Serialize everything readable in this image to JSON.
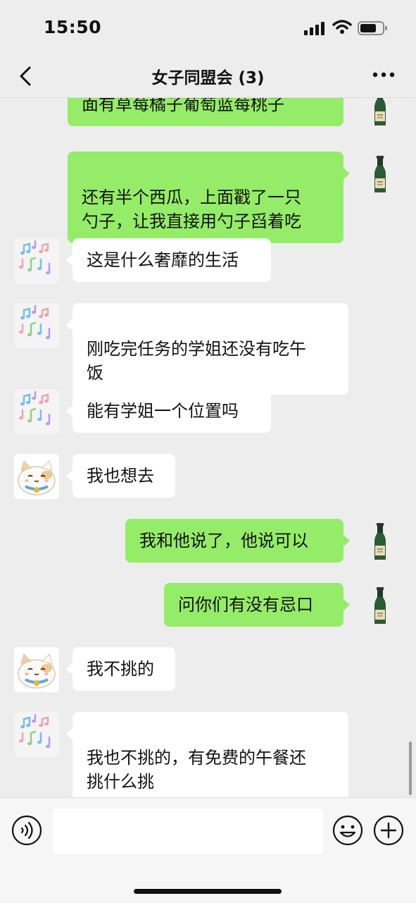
{
  "status_bar": {
    "time": "15:50"
  },
  "header": {
    "title": "女子同盟会 (3)"
  },
  "messages": [
    {
      "side": "right",
      "text": "面有草莓橘子葡萄蓝莓桃子",
      "avatar": "wine-bottle-avatar"
    },
    {
      "side": "right",
      "text": "还有半个西瓜，上面戳了一只\n勺子，让我直接用勺子舀着吃",
      "avatar": "wine-bottle-avatar"
    },
    {
      "side": "left",
      "text": "这是什么奢靡的生活",
      "avatar": "music-notes-avatar"
    },
    {
      "side": "left",
      "text": "刚吃完任务的学姐还没有吃午\n饭",
      "avatar": "music-notes-avatar"
    },
    {
      "side": "left",
      "text": "能有学姐一个位置吗",
      "avatar": "music-notes-avatar"
    },
    {
      "side": "left",
      "text": "我也想去",
      "avatar": "lucky-cat-avatar"
    },
    {
      "side": "right",
      "text": "我和他说了，他说可以",
      "avatar": "wine-bottle-avatar"
    },
    {
      "side": "right",
      "text": "问你们有没有忌口",
      "avatar": "wine-bottle-avatar"
    },
    {
      "side": "left",
      "text": "我不挑的",
      "avatar": "lucky-cat-avatar"
    },
    {
      "side": "left",
      "text": "我也不挑的，有免费的午餐还\n挑什么挑",
      "avatar": "music-notes-avatar"
    }
  ],
  "input_bar": {
    "placeholder": ""
  },
  "colors": {
    "self_bubble": "#95ec69",
    "other_bubble": "#ffffff",
    "background": "#ededed"
  }
}
